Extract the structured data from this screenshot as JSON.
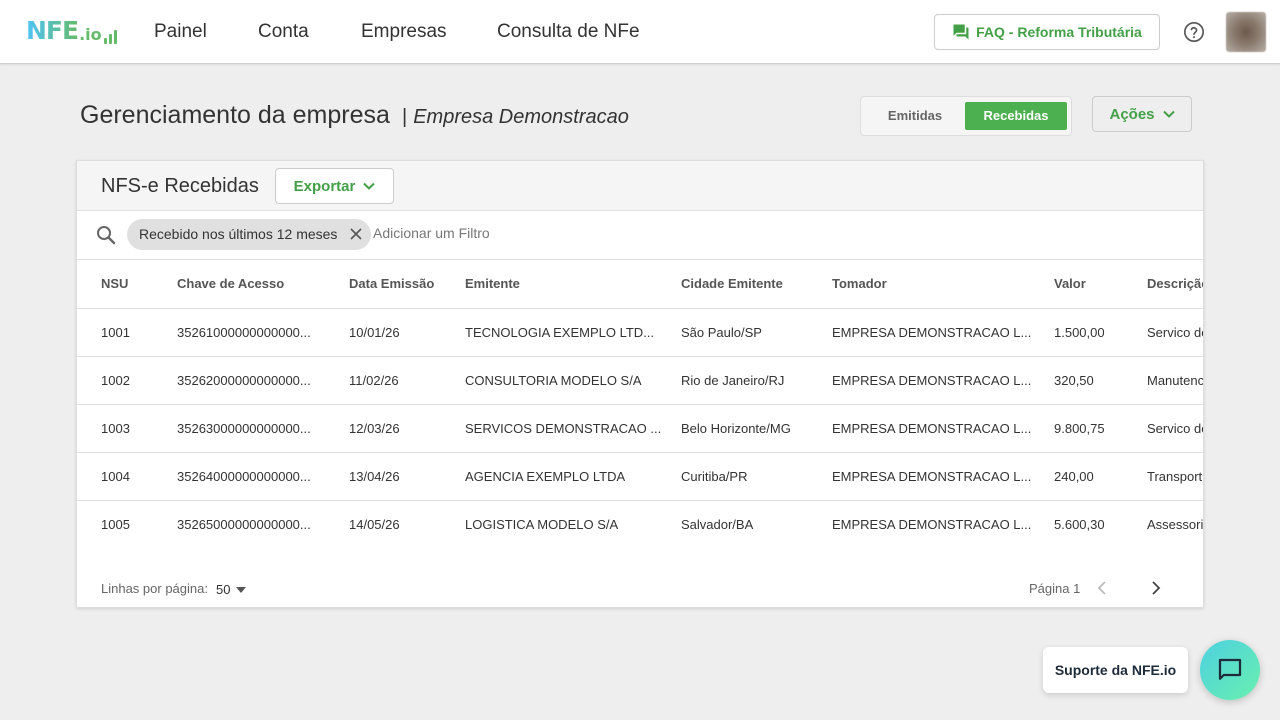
{
  "brand": {
    "logo_text": "NFE",
    "logo_suffix": ".io",
    "accent": "#4caf50",
    "gradient_start": "#4fc3f7",
    "gradient_end": "#66bb6a"
  },
  "nav": {
    "items": [
      {
        "label": "Painel"
      },
      {
        "label": "Conta"
      },
      {
        "label": "Empresas"
      },
      {
        "label": "Consulta de NFe"
      }
    ],
    "faq_label": "FAQ - Reforma Tributária",
    "faq_icon": "chat-bubble-icon",
    "help_icon": "help-circle-icon"
  },
  "header": {
    "title": "Gerenciamento da empresa",
    "separator": "|",
    "company": "Empresa Demonstracao",
    "toggle": [
      {
        "label": "Emitidas",
        "active": false
      },
      {
        "label": "Recebidas",
        "active": true
      }
    ],
    "actions_label": "Ações"
  },
  "card": {
    "title": "NFS-e Recebidas",
    "export_label": "Exportar",
    "filter_chip": "Recebido nos últimos 12 meses",
    "filter_placeholder": "Adicionar um Filtro"
  },
  "table": {
    "columns": [
      "NSU",
      "Chave de Acesso",
      "Data Emissão",
      "Emitente",
      "Cidade Emitente",
      "Tomador",
      "Valor",
      "Descrição"
    ],
    "rows": [
      [
        "1001",
        "35261000000000000...",
        "10/01/26",
        "TECNOLOGIA EXEMPLO LTD...",
        "São Paulo/SP",
        "EMPRESA DEMONSTRACAO L...",
        "1.500,00",
        "Servico de"
      ],
      [
        "1002",
        "35262000000000000...",
        "11/02/26",
        "CONSULTORIA MODELO S/A",
        "Rio de Janeiro/RJ",
        "EMPRESA DEMONSTRACAO L...",
        "320,50",
        "Manutenc"
      ],
      [
        "1003",
        "35263000000000000...",
        "12/03/26",
        "SERVICOS DEMONSTRACAO ...",
        "Belo Horizonte/MG",
        "EMPRESA DEMONSTRACAO L...",
        "9.800,75",
        "Servico de"
      ],
      [
        "1004",
        "35264000000000000...",
        "13/04/26",
        "AGENCIA EXEMPLO LTDA",
        "Curitiba/PR",
        "EMPRESA DEMONSTRACAO L...",
        "240,00",
        "Transport"
      ],
      [
        "1005",
        "35265000000000000...",
        "14/05/26",
        "LOGISTICA MODELO S/A",
        "Salvador/BA",
        "EMPRESA DEMONSTRACAO L...",
        "5.600,30",
        "Assessori"
      ]
    ]
  },
  "pagination": {
    "rows_label": "Linhas por página:",
    "rows_value": "50",
    "page_label": "Página 1"
  },
  "support": {
    "label": "Suporte da NFE.io",
    "icon": "chat-icon"
  }
}
